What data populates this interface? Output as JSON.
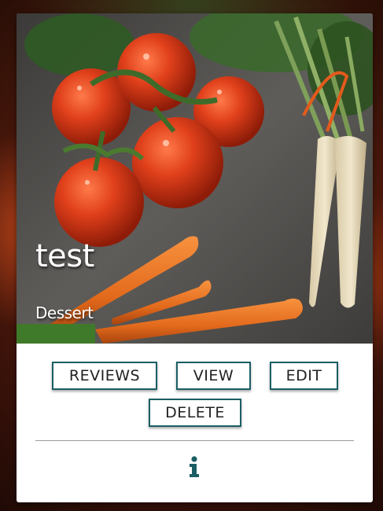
{
  "recipe_card": {
    "title": "test",
    "category": "Dessert",
    "image_icon": "vegetables-photo",
    "buttons": {
      "reviews": "REVIEWS",
      "view": "VIEW",
      "edit": "EDIT",
      "delete": "DELETE"
    },
    "info_icon": "info-icon"
  },
  "colors": {
    "button_border": "#1b5e64",
    "info_icon": "#1b5e64",
    "card_background": "#ffffff"
  }
}
